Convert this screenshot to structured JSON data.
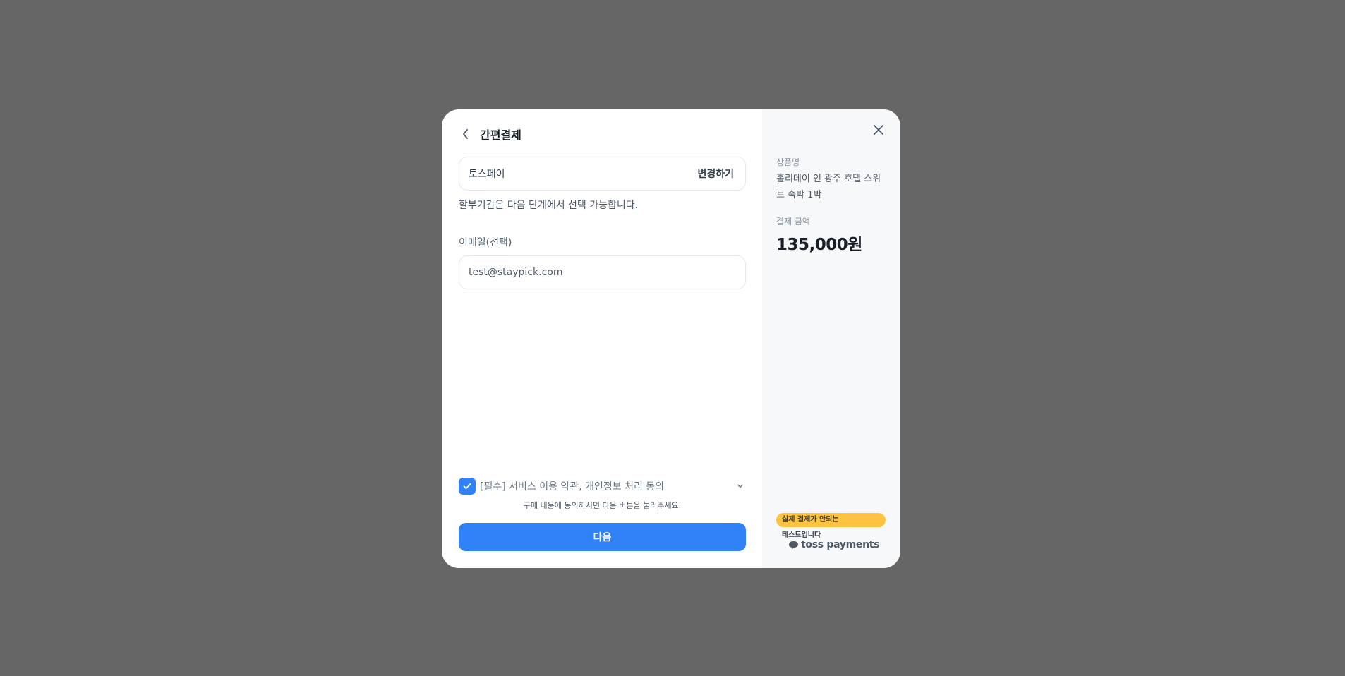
{
  "header": {
    "title": "간편결제"
  },
  "payment_method": {
    "name": "토스페이",
    "change_label": "변경하기",
    "installment_note": "할부기간은 다음 단계에서 선택 가능합니다."
  },
  "email": {
    "label": "이메일(선택)",
    "value": "test@staypick.com"
  },
  "agreement": {
    "checked": true,
    "label": "[필수] 서비스 이용 약관, 개인정보 처리 동의",
    "sub_text": "구매 내용에 동의하시면 다음 버튼을 눌러주세요."
  },
  "next_button": {
    "label": "다음"
  },
  "summary": {
    "product_label": "상품명",
    "product_name": "홀리데이 인 광주 호텔 스위트 숙박 1박",
    "amount_label": "결제 금액",
    "amount_value": "135,000원"
  },
  "test_notice": {
    "badge": "실제 결제가 안되는",
    "text": "테스트입니다",
    "brand": "toss payments"
  },
  "colors": {
    "overlay": "#666666",
    "primary": "#3182f6",
    "badge": "#ffc342",
    "summary_bg": "#f7f8fa"
  },
  "icons": {
    "back": "chevron-left-icon",
    "close": "close-icon",
    "check": "check-icon",
    "expand": "chevron-down-icon",
    "brand": "toss-logo-icon"
  }
}
